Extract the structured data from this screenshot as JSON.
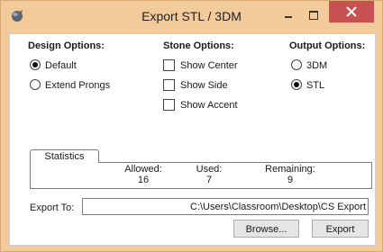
{
  "window": {
    "title": "Export STL / 3DM",
    "minimize_label": "–",
    "maximize_label": "□",
    "close_label": "×"
  },
  "design_options": {
    "title": "Design Options:",
    "options": [
      {
        "label": "Default",
        "checked": true
      },
      {
        "label": "Extend Prongs",
        "checked": false
      }
    ]
  },
  "stone_options": {
    "title": "Stone Options:",
    "options": [
      {
        "label": "Show Center",
        "checked": false
      },
      {
        "label": "Show Side",
        "checked": false
      },
      {
        "label": "Show Accent",
        "checked": false
      }
    ]
  },
  "output_options": {
    "title": "Output Options:",
    "options": [
      {
        "label": "3DM",
        "checked": false
      },
      {
        "label": "STL",
        "checked": true
      }
    ]
  },
  "statistics": {
    "tab_label": "Statistics",
    "columns": [
      {
        "label": "Allowed:",
        "value": "16"
      },
      {
        "label": "Used:",
        "value": "7"
      },
      {
        "label": "Remaining:",
        "value": "9"
      }
    ]
  },
  "export": {
    "label": "Export To:",
    "path": "C:\\Users\\Classroom\\Desktop\\CS Export",
    "browse_label": "Browse...",
    "export_label": "Export"
  },
  "colors": {
    "titlebar": "#f3ca9a",
    "close_button": "#c75050"
  }
}
